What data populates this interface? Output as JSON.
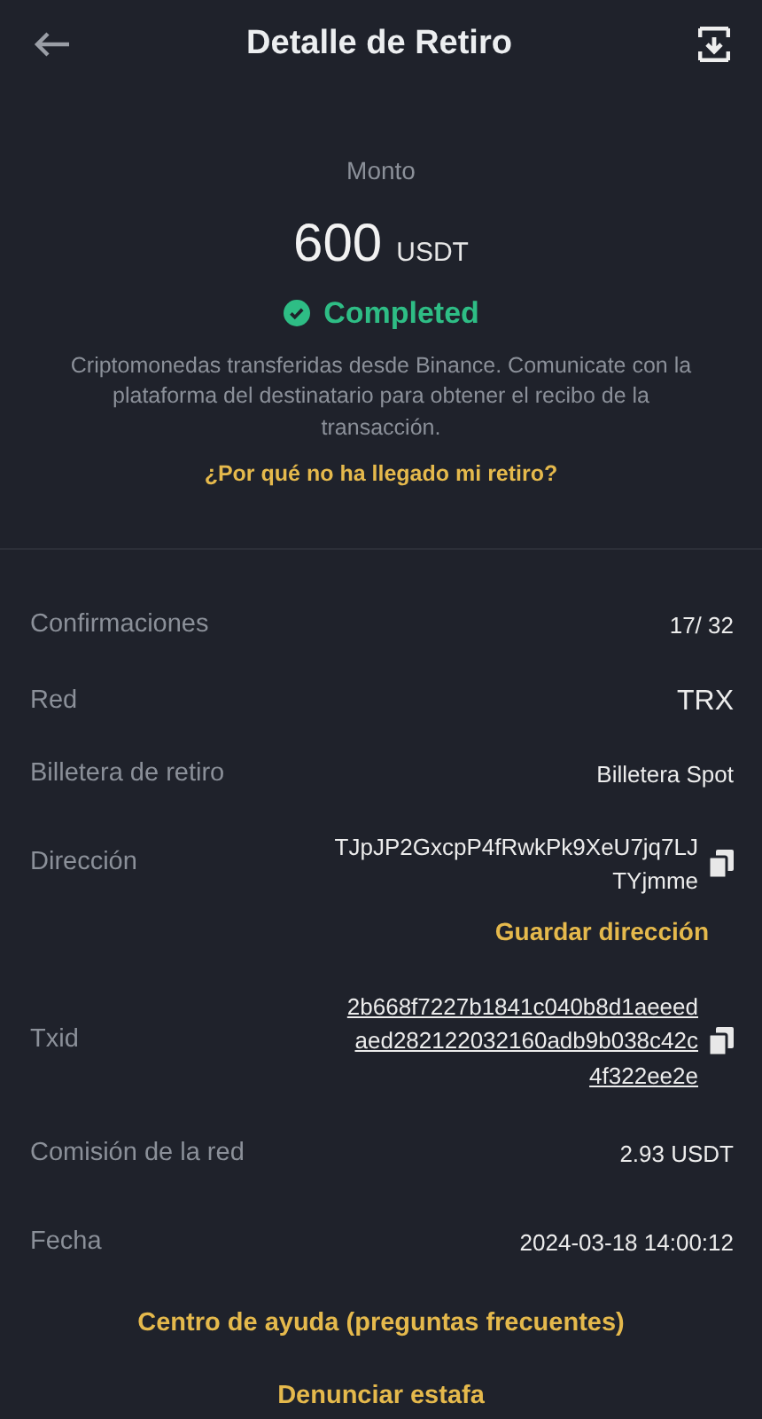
{
  "header": {
    "title": "Detalle de Retiro"
  },
  "summary": {
    "label": "Monto",
    "amount": "600",
    "unit": "USDT",
    "status": "Completed",
    "succeeded": true,
    "note": "Criptomonedas transferidas desde Binance. Comunicate con la plataforma del destinatario para obtener el recibo de la transacción.",
    "help_link": "¿Por qué no ha llegado mi retiro?"
  },
  "details": [
    {
      "label": "Confirmaciones",
      "lines": [
        "17/ 32"
      ],
      "kind": "plain"
    },
    {
      "label": "Red",
      "lines": [
        "TRX"
      ],
      "kind": "large"
    },
    {
      "label": "Billetera de retiro",
      "lines": [
        "Billetera Spot"
      ],
      "kind": "plain"
    },
    {
      "label": "Dirección",
      "lines": [
        "TJpJP2GxcpP4fRwkPk9XeU7jq7LJ",
        "TYjmme"
      ],
      "kind": "copy",
      "action": "Guardar dirección"
    },
    {
      "label": "Txid",
      "lines": [
        "2b668f7227b1841c040b8d1aeeed",
        "aed282122032160adb9b038c42c",
        "4f322ee2e"
      ],
      "kind": "copy-link"
    },
    {
      "label": "Comisión de la red",
      "lines": [
        "2.93 USDT"
      ],
      "kind": "plain"
    },
    {
      "label": "Fecha",
      "lines": [
        "2024-03-18 14:00:12"
      ],
      "kind": "plain"
    }
  ],
  "footer_links": [
    "Centro de ayuda (preguntas frecuentes)",
    "Denunciar estafa"
  ]
}
